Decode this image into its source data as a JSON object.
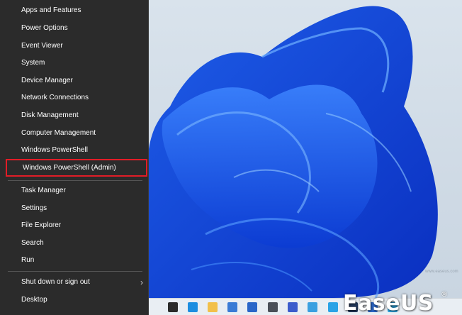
{
  "menu": {
    "items": [
      {
        "label": "Apps and Features"
      },
      {
        "label": "Power Options"
      },
      {
        "label": "Event Viewer"
      },
      {
        "label": "System"
      },
      {
        "label": "Device Manager"
      },
      {
        "label": "Network Connections"
      },
      {
        "label": "Disk Management"
      },
      {
        "label": "Computer Management"
      },
      {
        "label": "Windows PowerShell"
      },
      {
        "label": "Windows PowerShell (Admin)",
        "highlighted": true
      },
      {
        "label": "Task Manager"
      },
      {
        "label": "Settings"
      },
      {
        "label": "File Explorer"
      },
      {
        "label": "Search"
      },
      {
        "label": "Run"
      },
      {
        "label": "Shut down or sign out",
        "submenu": true
      },
      {
        "label": "Desktop"
      }
    ],
    "highlight_color": "#e11d27",
    "submenu_glyph": "›"
  },
  "taskbar": {
    "icons": [
      {
        "name": "task-view-icon",
        "color": "#2b2b2b"
      },
      {
        "name": "edge-icon",
        "color": "#1d8ee0"
      },
      {
        "name": "file-explorer-icon",
        "color": "#f2c04a"
      },
      {
        "name": "store-icon",
        "color": "#3a7bd5"
      },
      {
        "name": "mail-icon",
        "color": "#2a66c8"
      },
      {
        "name": "keyboard-icon",
        "color": "#4a4f58"
      },
      {
        "name": "app-icon",
        "color": "#3b5ccc"
      },
      {
        "name": "photos-icon",
        "color": "#3aa0e0"
      },
      {
        "name": "skype-icon",
        "color": "#2aa3e6"
      },
      {
        "name": "steam-icon",
        "color": "#23395d"
      },
      {
        "name": "mail-icon-2",
        "color": "#2a66c8"
      },
      {
        "name": "telegram-icon",
        "color": "#2ba3dd"
      }
    ]
  },
  "logo": {
    "text": "EaseUS",
    "reg": "®"
  },
  "watermark": {
    "text": "www.easeus.com"
  }
}
